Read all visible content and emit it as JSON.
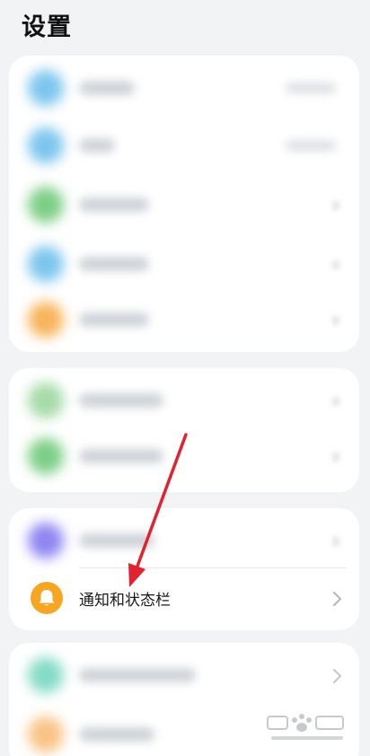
{
  "header": {
    "title": "设置"
  },
  "notification_item": {
    "label": "通知和状态栏"
  },
  "colors": {
    "blue": "#7cc6ee",
    "green": "#7ccf86",
    "orange": "#f8b45a",
    "light_green": "#a5dba8",
    "purple": "#8f86f2",
    "teal": "#85dcc7",
    "light_orange": "#f9c485",
    "bell": "#f5a623",
    "arrow": "#e0232e"
  }
}
